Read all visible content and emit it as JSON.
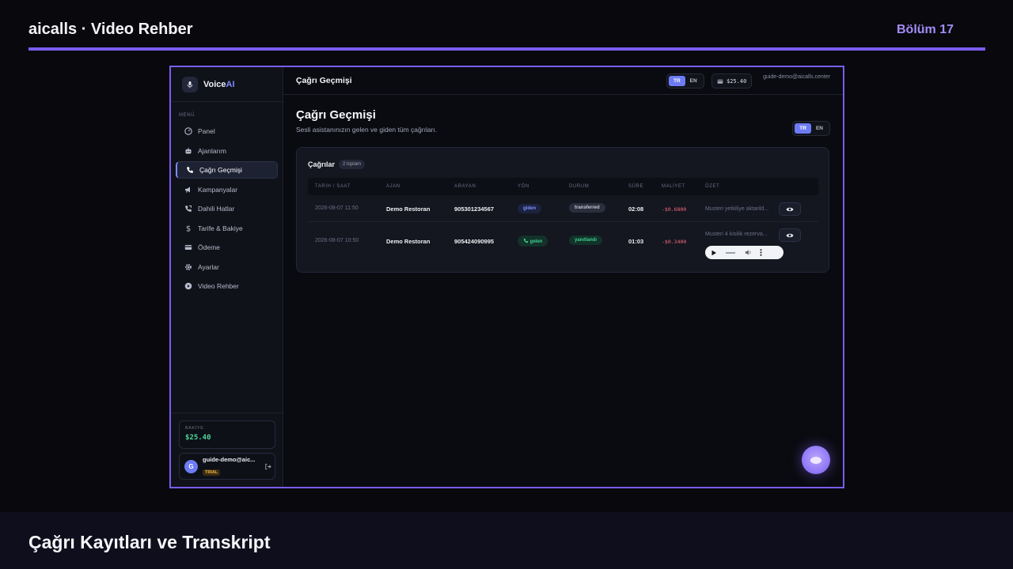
{
  "header": {
    "title": "aicalls · Video Rehber",
    "chapter": "Bölüm 17"
  },
  "footer": {
    "title": "Çağrı Kayıtları ve Transkript"
  },
  "app": {
    "brand": {
      "name_main": "Voice",
      "name_accent": "AI"
    },
    "sidebar": {
      "menu_label": "MENÜ",
      "items": [
        {
          "label": "Panel",
          "icon": "dashboard-icon"
        },
        {
          "label": "Ajanlarım",
          "icon": "bot-icon"
        },
        {
          "label": "Çağrı Geçmişi",
          "icon": "phone-icon",
          "active": true
        },
        {
          "label": "Kampanyalar",
          "icon": "megaphone-icon"
        },
        {
          "label": "Dahili Hatlar",
          "icon": "phone-forward-icon"
        },
        {
          "label": "Tarife & Bakiye",
          "icon": "dollar-icon"
        },
        {
          "label": "Ödeme",
          "icon": "credit-card-icon"
        },
        {
          "label": "Ayarlar",
          "icon": "gear-icon"
        },
        {
          "label": "Video Rehber",
          "icon": "play-circle-icon"
        }
      ],
      "balance_label": "BAKİYE",
      "balance_value": "$25.40",
      "user_initial": "G",
      "user_email": "guide-demo@aic...",
      "plan_badge": "TRIAL"
    },
    "topbar": {
      "title": "Çağrı Geçmişi",
      "lang": [
        "TR",
        "EN"
      ],
      "balance": "$25.40",
      "email": "guide-demo@aicalls.center"
    },
    "page": {
      "title": "Çağrı Geçmişi",
      "subtitle": "Sesli asistanınızın gelen ve giden tüm çağrıları.",
      "lang": [
        "TR",
        "EN"
      ]
    },
    "calls": {
      "title": "Çağrılar",
      "count": "2 toplam",
      "columns": [
        "TARİH / SAAT",
        "AJAN",
        "ARAYAN",
        "YÖN",
        "DURUM",
        "SÜRE",
        "MALİYET",
        "ÖZET"
      ],
      "rows": [
        {
          "datetime": "2026-08-07 11:50",
          "agent": "Demo Restoran",
          "caller": "905301234567",
          "direction": "giden",
          "status": "transferred",
          "duration": "02:08",
          "cost": "-$0.6800",
          "summary": "Musteri yetkiliye aktarild..."
        },
        {
          "datetime": "2026-08-07 10:50",
          "agent": "Demo Restoran",
          "caller": "905424090995",
          "direction": "gelen",
          "status": "yanıtlandı",
          "duration": "01:03",
          "cost": "-$0.3400",
          "summary": "Musteri 4 kisilik rezerva..."
        }
      ]
    },
    "colors": {
      "accent": "#7b5cf0",
      "primary": "#6d7cf5",
      "success": "#3fcf8e",
      "danger": "#f06b78"
    }
  }
}
